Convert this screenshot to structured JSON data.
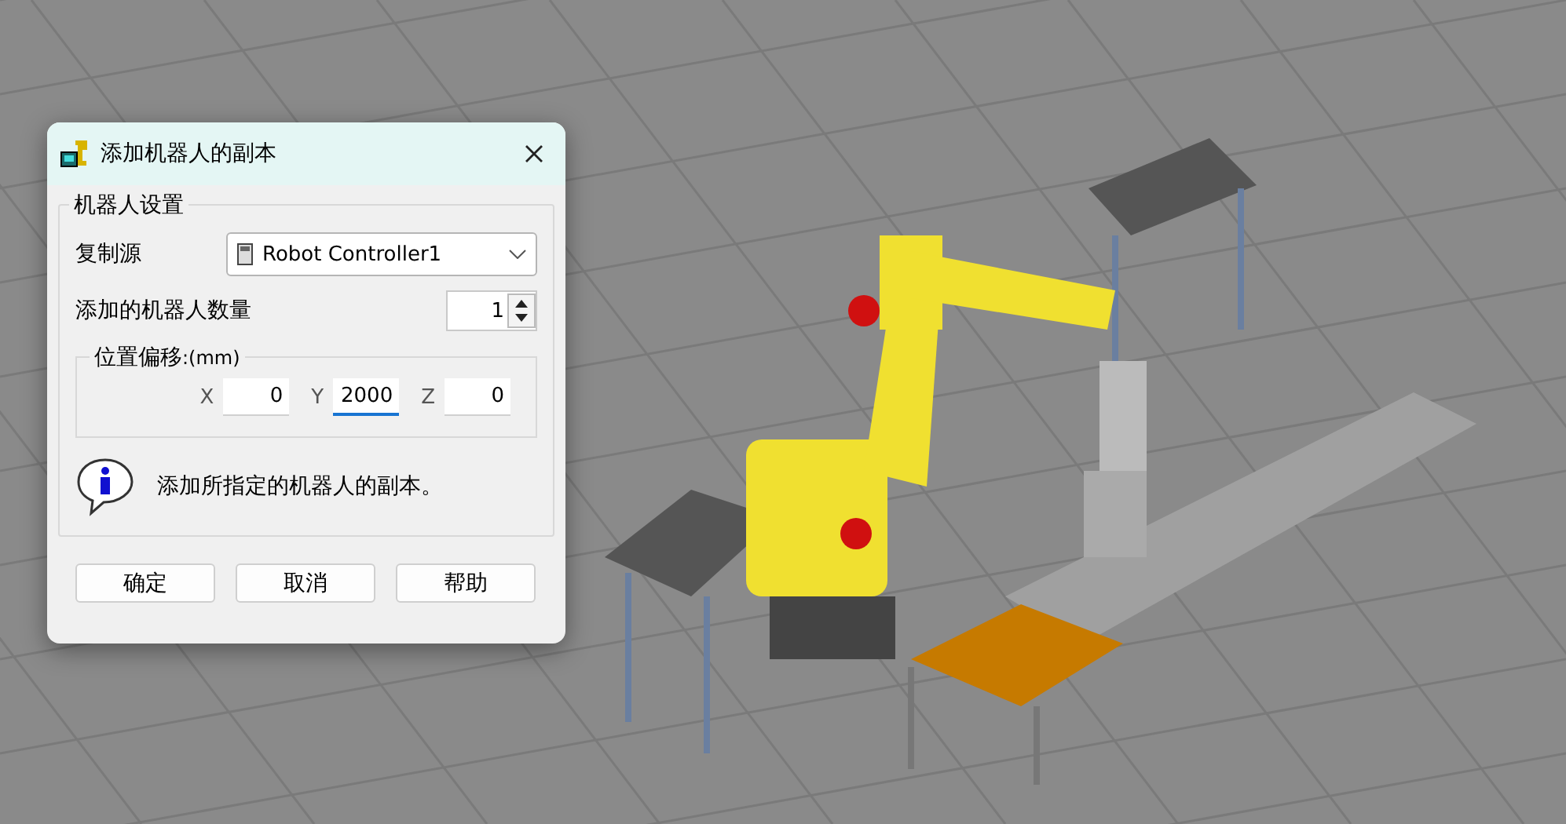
{
  "dialog": {
    "title": "添加机器人的副本",
    "group": {
      "title": "机器人设置",
      "source": {
        "label": "复制源",
        "value": "Robot Controller1"
      },
      "count": {
        "label": "添加的机器人数量",
        "value": "1"
      },
      "offset": {
        "title": "位置偏移",
        "unit": ":(mm)",
        "fields": [
          {
            "label": "X",
            "value": "0",
            "focused": false
          },
          {
            "label": "Y",
            "value": "2000",
            "focused": true
          },
          {
            "label": "Z",
            "value": "0",
            "focused": false
          }
        ]
      },
      "info": "添加所指定的机器人的副本。"
    },
    "buttons": [
      "确定",
      "取消",
      "帮助"
    ]
  }
}
